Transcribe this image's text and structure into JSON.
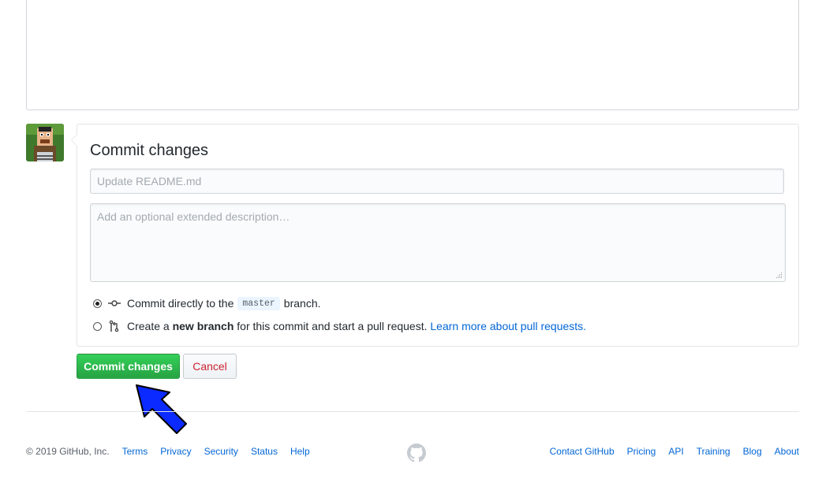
{
  "commit_form": {
    "title": "Commit changes",
    "summary_placeholder": "Update README.md",
    "description_placeholder": "Add an optional extended description…",
    "options": {
      "direct_pre": "Commit directly to the",
      "branch_name": "master",
      "direct_post": "branch.",
      "new_branch_pre": "Create a",
      "new_branch_bold": "new branch",
      "new_branch_post": "for this commit and start a pull request.",
      "learn_more_link": "Learn more about pull requests."
    },
    "selected_option": "commit-directly",
    "commit_button": "Commit changes",
    "cancel_button": "Cancel"
  },
  "footer": {
    "copyright": "© 2019 GitHub, Inc.",
    "left_links": [
      "Terms",
      "Privacy",
      "Security",
      "Status",
      "Help"
    ],
    "right_links": [
      "Contact GitHub",
      "Pricing",
      "API",
      "Training",
      "Blog",
      "About"
    ]
  },
  "icons": {
    "avatar": "user-avatar",
    "commit_directly": "git-commit-icon",
    "new_branch": "git-pull-request-icon",
    "footer_logo": "github-mark-icon",
    "annotation": "blue-pointer-arrow-icon"
  },
  "colors": {
    "primary_button": "#2ea44f",
    "cancel_text": "#cb2431",
    "link": "#0366d6",
    "annotation_arrow": "#0a2aff"
  }
}
